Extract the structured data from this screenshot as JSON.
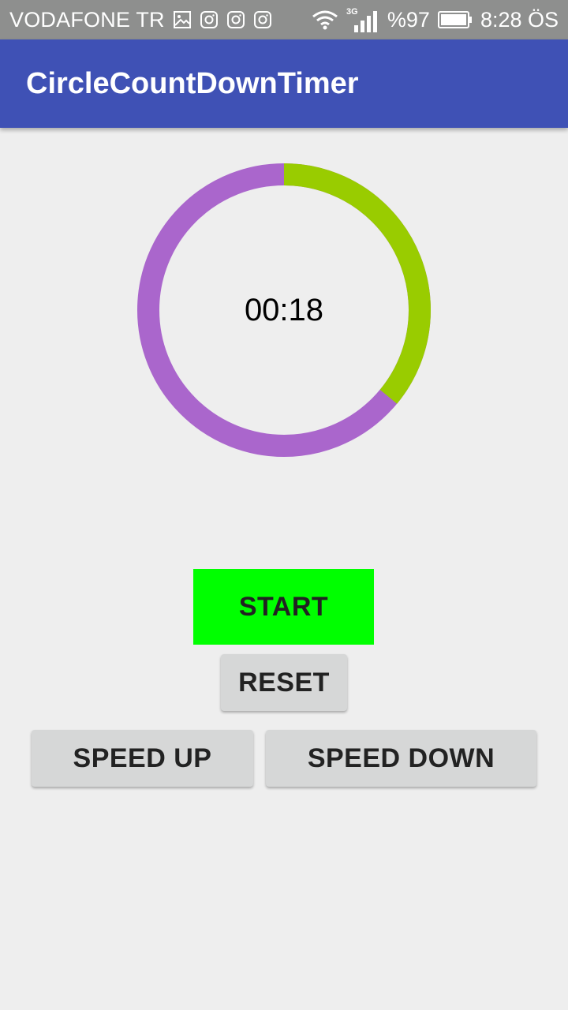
{
  "status_bar": {
    "carrier": "VODAFONE TR",
    "network": "3G",
    "battery": "%97",
    "time": "8:28 ÖS"
  },
  "app_bar": {
    "title": "CircleCountDownTimer"
  },
  "timer": {
    "display": "00:18",
    "progress_fraction": 0.36,
    "colors": {
      "progress": "#99cc00",
      "remaining": "#aa66cc"
    }
  },
  "buttons": {
    "start": "START",
    "reset": "RESET",
    "speed_up": "SPEED UP",
    "speed_down": "SPEED DOWN"
  },
  "colors": {
    "app_bar": "#3f51b5",
    "status_bar": "#8e8f8e",
    "start_button": "#00ff00",
    "gray_button": "#d6d7d7",
    "background": "#eeeeee"
  }
}
